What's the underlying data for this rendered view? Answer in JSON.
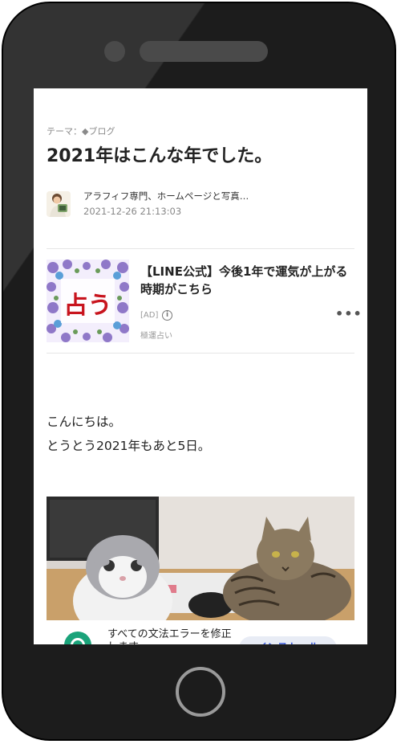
{
  "article": {
    "theme": "テーマ：◆ブログ",
    "title": "2021年はこんな年でした。",
    "author": "アラフィフ専門、ホームページと写真…",
    "date": "2021-12-26 21:13:03"
  },
  "ad": {
    "thumb_text": "占う",
    "title": "【LINE公式】今後1年で運気が上がる時期がこちら",
    "badge": "[AD]",
    "info_icon": "i",
    "more": "•••",
    "source": "極運占い"
  },
  "body": {
    "line1": "こんにちは。",
    "line2": "とうとう2021年もあと5日。"
  },
  "banner": {
    "text": "すべての文法エラーを修正します",
    "button": "インストール"
  },
  "colors": {
    "accent": "#3b5bdb",
    "banner_icon": "#1aa37a",
    "ad_thumb_text": "#c8141e"
  }
}
